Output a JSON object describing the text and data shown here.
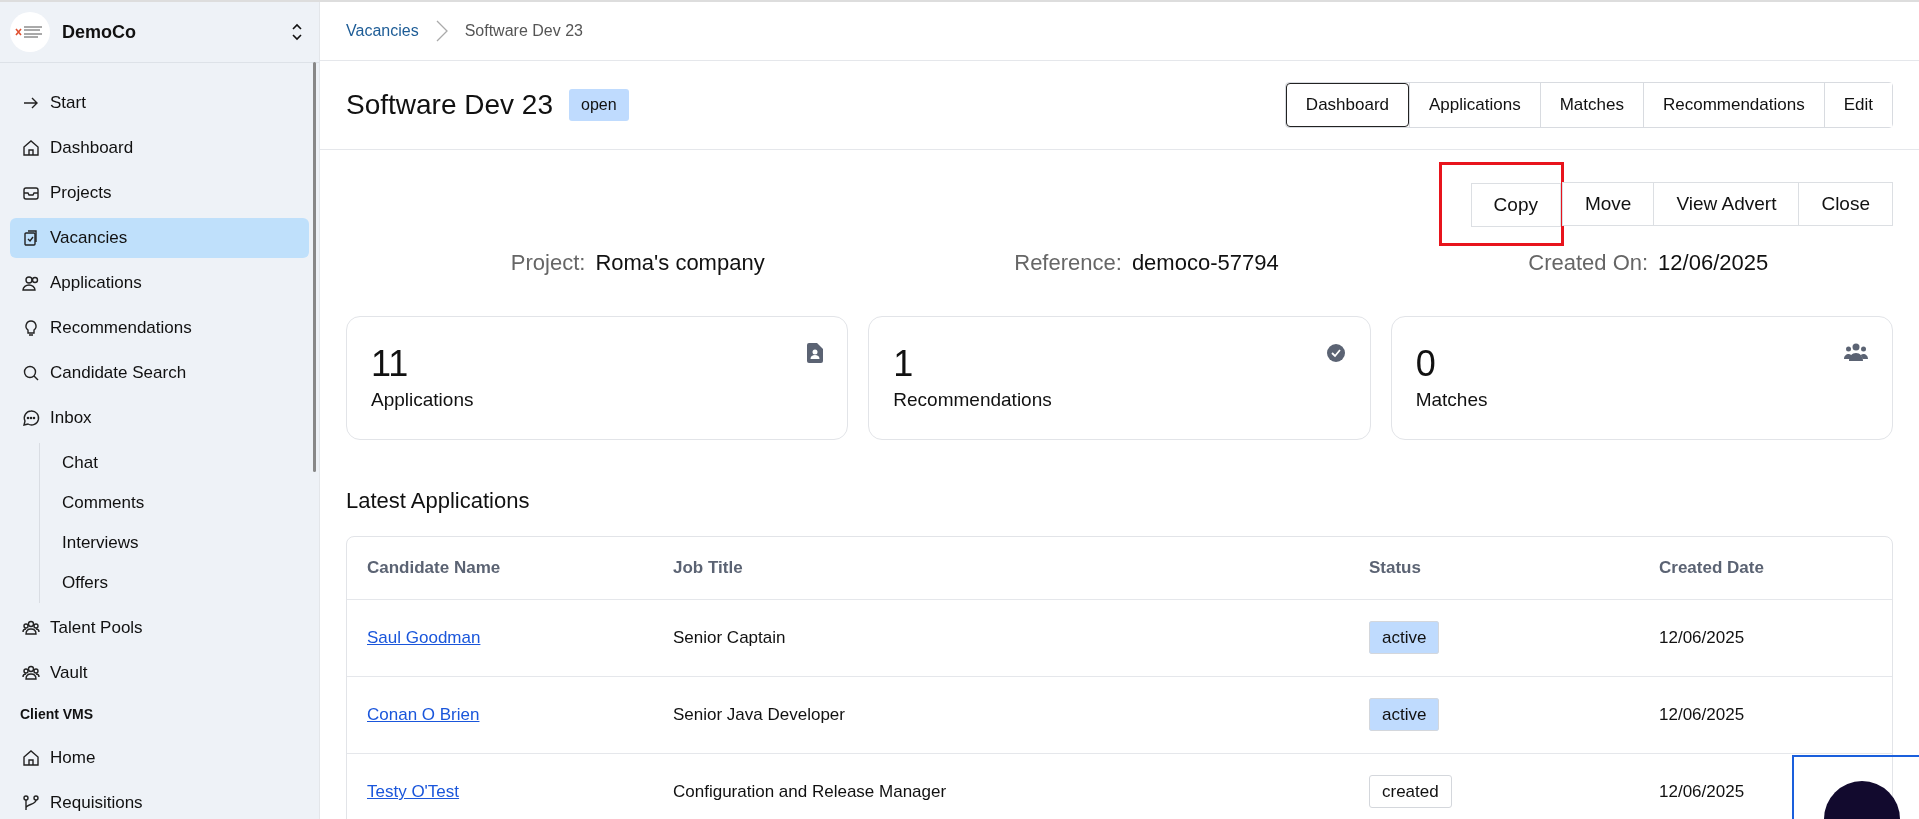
{
  "sidebar": {
    "org": {
      "name": "DemoCo"
    },
    "items": [
      {
        "label": "Start",
        "selected": false
      },
      {
        "label": "Dashboard",
        "selected": false
      },
      {
        "label": "Projects",
        "selected": false
      },
      {
        "label": "Vacancies",
        "selected": true
      },
      {
        "label": "Applications",
        "selected": false
      },
      {
        "label": "Recommendations",
        "selected": false
      },
      {
        "label": "Candidate Search",
        "selected": false
      },
      {
        "label": "Inbox",
        "selected": false,
        "children": [
          {
            "label": "Chat",
            "selected": false
          },
          {
            "label": "Comments",
            "selected": false
          },
          {
            "label": "Interviews",
            "selected": false
          },
          {
            "label": "Offers",
            "selected": false
          }
        ]
      },
      {
        "label": "Talent Pools",
        "selected": false
      },
      {
        "label": "Vault",
        "selected": false
      }
    ],
    "section_title": "Client VMS",
    "section_items": [
      {
        "label": "Home",
        "selected": false
      },
      {
        "label": "Requisitions",
        "selected": false
      }
    ]
  },
  "breadcrumb": [
    "Vacancies",
    "Software Dev 23"
  ],
  "title": "Software Dev 23",
  "status_badge": "open",
  "tabs": [
    {
      "label": "Dashboard",
      "selected": true
    },
    {
      "label": "Applications",
      "selected": false
    },
    {
      "label": "Matches",
      "selected": false
    },
    {
      "label": "Recommendations",
      "selected": false
    },
    {
      "label": "Edit",
      "selected": false
    }
  ],
  "actions": [
    {
      "label": "Copy",
      "highlighted": true
    },
    {
      "label": "Move",
      "highlighted": false
    },
    {
      "label": "View Advert",
      "highlighted": false
    },
    {
      "label": "Close",
      "highlighted": false
    }
  ],
  "meta": [
    {
      "label": "Project:",
      "value": "Roma's company"
    },
    {
      "label": "Reference:",
      "value": "democo-57794"
    },
    {
      "label": "Created On:",
      "value": "12/06/2025"
    }
  ],
  "stats": [
    {
      "value": "11",
      "label": "Applications"
    },
    {
      "value": "1",
      "label": "Recommendations"
    },
    {
      "value": "0",
      "label": "Matches"
    }
  ],
  "latest_applications": {
    "title": "Latest Applications",
    "columns": [
      "Candidate Name",
      "Job Title",
      "Status",
      "Created Date"
    ],
    "rows": [
      {
        "candidate": "Saul Goodman",
        "job_title": "Senior Captain",
        "status": "active",
        "color": "#bfdbfe",
        "created": "12/06/2025"
      },
      {
        "candidate": "Conan O Brien",
        "job_title": "Senior Java Developer",
        "status": "active",
        "color": "#bfdbfe",
        "created": "12/06/2025"
      },
      {
        "candidate": "Testy O'Test",
        "job_title": "Configuration and Release Manager",
        "status": "created",
        "color": "#ffffff",
        "created": "12/06/2025"
      }
    ]
  }
}
